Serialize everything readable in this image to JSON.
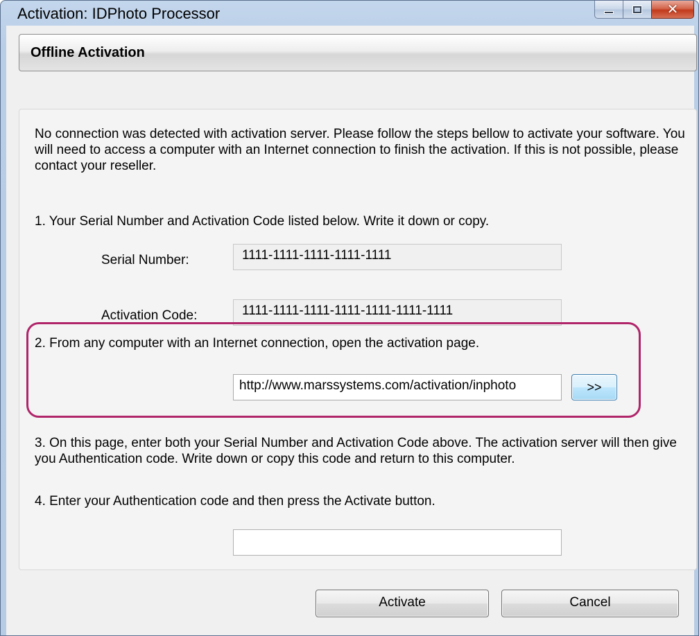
{
  "window": {
    "title": "Activation: IDPhoto Processor",
    "close_symbol": "✕"
  },
  "header": {
    "title": "Offline Activation"
  },
  "content": {
    "intro": "No connection was detected with activation server. Please follow the steps bellow to activate your software. You will need to access a computer with an Internet connection to finish the activation. If this is not possible, please contact your reseller.",
    "step1": "1. Your Serial Number and Activation Code listed below. Write it down or copy.",
    "serial_label": "Serial Number:",
    "serial_value": "1111-1111-1111-1111-1111",
    "activation_label": "Activation Code:",
    "activation_value": "1111-1111-1111-1111-1111-1111-1111",
    "step2": "2. From any computer with an Internet connection, open the activation page.",
    "url_value": "http://www.marssystems.com/activation/inphoto",
    "open_button_label": ">>",
    "step3": "3. On this page, enter both your Serial Number and Activation Code above. The activation server will then give you Authentication code. Write down or copy this code and return to this computer.",
    "step4": "4. Enter your Authentication code and then press the Activate button.",
    "auth_value": ""
  },
  "buttons": {
    "activate": "Activate",
    "cancel": "Cancel"
  },
  "colors": {
    "highlight_border": "#b0246a",
    "title_bar": "#c3d6ec"
  }
}
